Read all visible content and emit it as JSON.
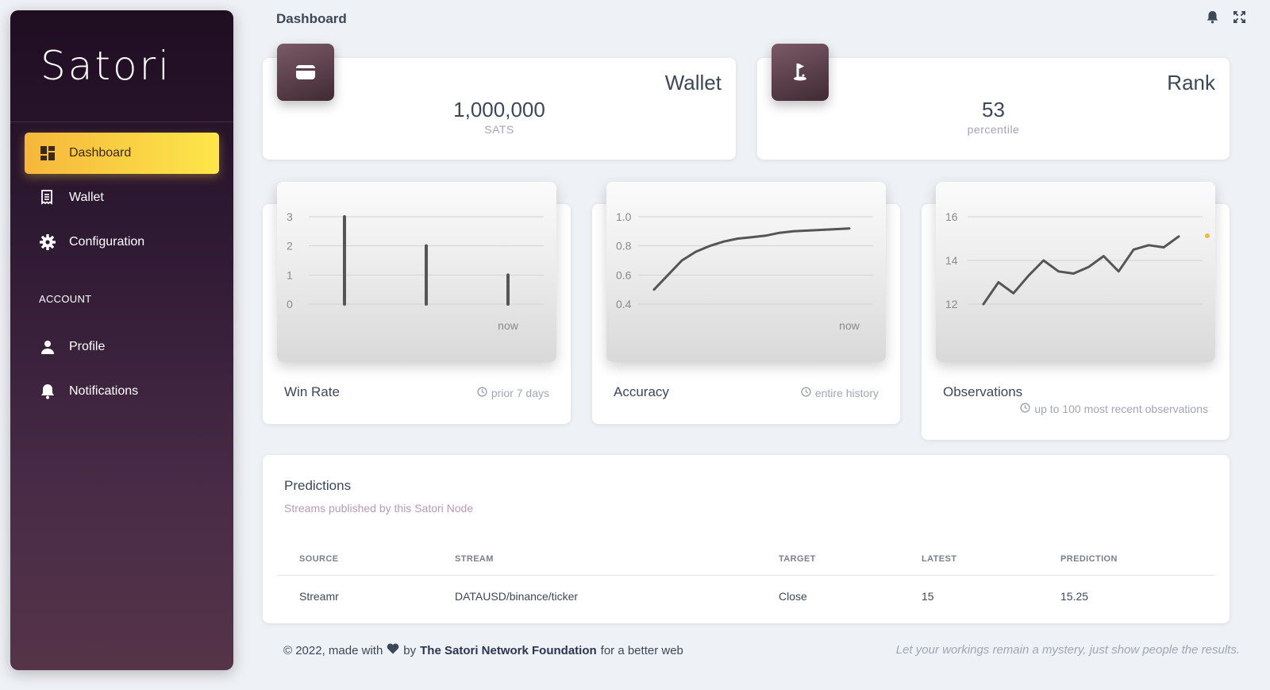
{
  "brand": {
    "name": "Satori"
  },
  "header": {
    "title": "Dashboard"
  },
  "sidebar": {
    "items": [
      {
        "label": "Dashboard",
        "icon": "dashboard-icon",
        "active": true
      },
      {
        "label": "Wallet",
        "icon": "receipt-icon",
        "active": false
      },
      {
        "label": "Configuration",
        "icon": "gear-icon",
        "active": false
      }
    ],
    "section_label": "ACCOUNT",
    "account_items": [
      {
        "label": "Profile",
        "icon": "person-icon"
      },
      {
        "label": "Notifications",
        "icon": "bell-icon"
      }
    ]
  },
  "stats": {
    "wallet": {
      "title": "Wallet",
      "value": "1,000,000",
      "unit": "SATS",
      "icon": "wallet-icon"
    },
    "rank": {
      "title": "Rank",
      "value": "53",
      "unit": "percentile",
      "icon": "golf-flag-icon"
    }
  },
  "chart_data": [
    {
      "type": "bar",
      "title": "Win Rate",
      "meta": "prior 7 days",
      "categories": [
        "",
        "",
        "now"
      ],
      "values": [
        3,
        2,
        1
      ],
      "ylim": [
        0,
        3
      ],
      "yticks": [
        0,
        1,
        2,
        3
      ],
      "grid": true,
      "color": "#555555"
    },
    {
      "type": "line",
      "title": "Accuracy",
      "meta": "entire history",
      "xlabel_last": "now",
      "values": [
        0.5,
        0.6,
        0.7,
        0.76,
        0.8,
        0.83,
        0.85,
        0.86,
        0.87,
        0.89,
        0.9,
        0.905,
        0.91,
        0.915,
        0.92
      ],
      "ylim": [
        0.4,
        1.0
      ],
      "yticks": [
        "0.4",
        "0.6",
        "0.8",
        "1.0"
      ],
      "grid": true,
      "color": "#555555"
    },
    {
      "type": "line",
      "title": "Observations",
      "meta": "up to 100 most recent observations",
      "values": [
        12,
        13,
        12.5,
        13.3,
        14,
        13.5,
        13.4,
        13.7,
        14.2,
        13.5,
        14.5,
        14.7,
        14.6,
        15.1
      ],
      "ylim": [
        12,
        16
      ],
      "yticks": [
        12,
        14,
        16
      ],
      "grid": true,
      "color": "#555555",
      "marker_color": "#f6b73c"
    }
  ],
  "predictions": {
    "title": "Predictions",
    "subtitle": "Streams published by this Satori Node",
    "columns": [
      "SOURCE",
      "STREAM",
      "TARGET",
      "LATEST",
      "PREDICTION"
    ],
    "rows": [
      [
        "Streamr",
        "DATAUSD/binance/ticker",
        "Close",
        "15",
        "15.25"
      ]
    ]
  },
  "footer": {
    "copyright": "© 2022, made with",
    "by": "by",
    "org": "The Satori Network Foundation",
    "tail": "for a better web",
    "quote": "Let your workings remain a mystery, just show people the results."
  }
}
